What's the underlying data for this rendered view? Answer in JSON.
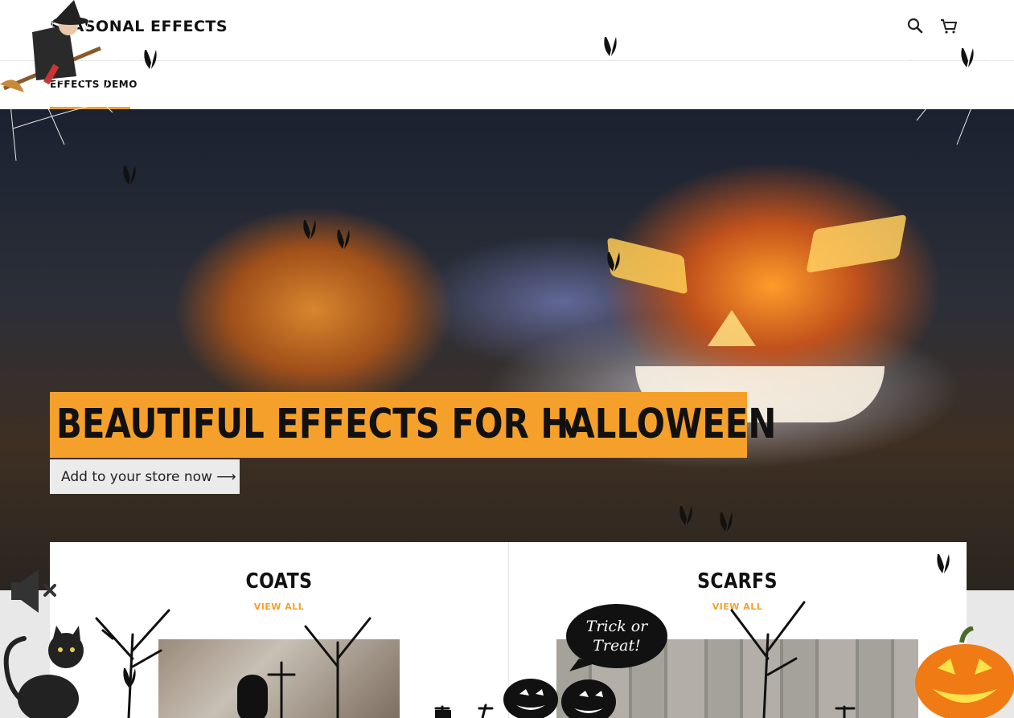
{
  "header": {
    "logo_text": "SEASONAL EFFECTS",
    "nav": [
      {
        "label": "EFFECTS DEMO"
      }
    ]
  },
  "hero": {
    "title": "BEAUTIFUL EFFECTS FOR HALLOWEEN",
    "cta_label": "Add to your store now ⟶"
  },
  "collections": [
    {
      "title": "COATS",
      "link": "VIEW ALL"
    },
    {
      "title": "SCARFS",
      "link": "VIEW ALL"
    }
  ],
  "decorations": {
    "speech_bubble_text": "Trick or Treat!"
  },
  "colors": {
    "accent": "#f5a02a",
    "header_bg": "#ffffff",
    "button_bg": "#ebebeb"
  },
  "icons": [
    "search-icon",
    "cart-icon",
    "mute-icon",
    "bat-icon",
    "witch-icon",
    "cat-icon",
    "pumpkin-icon",
    "spider-web-icon"
  ]
}
